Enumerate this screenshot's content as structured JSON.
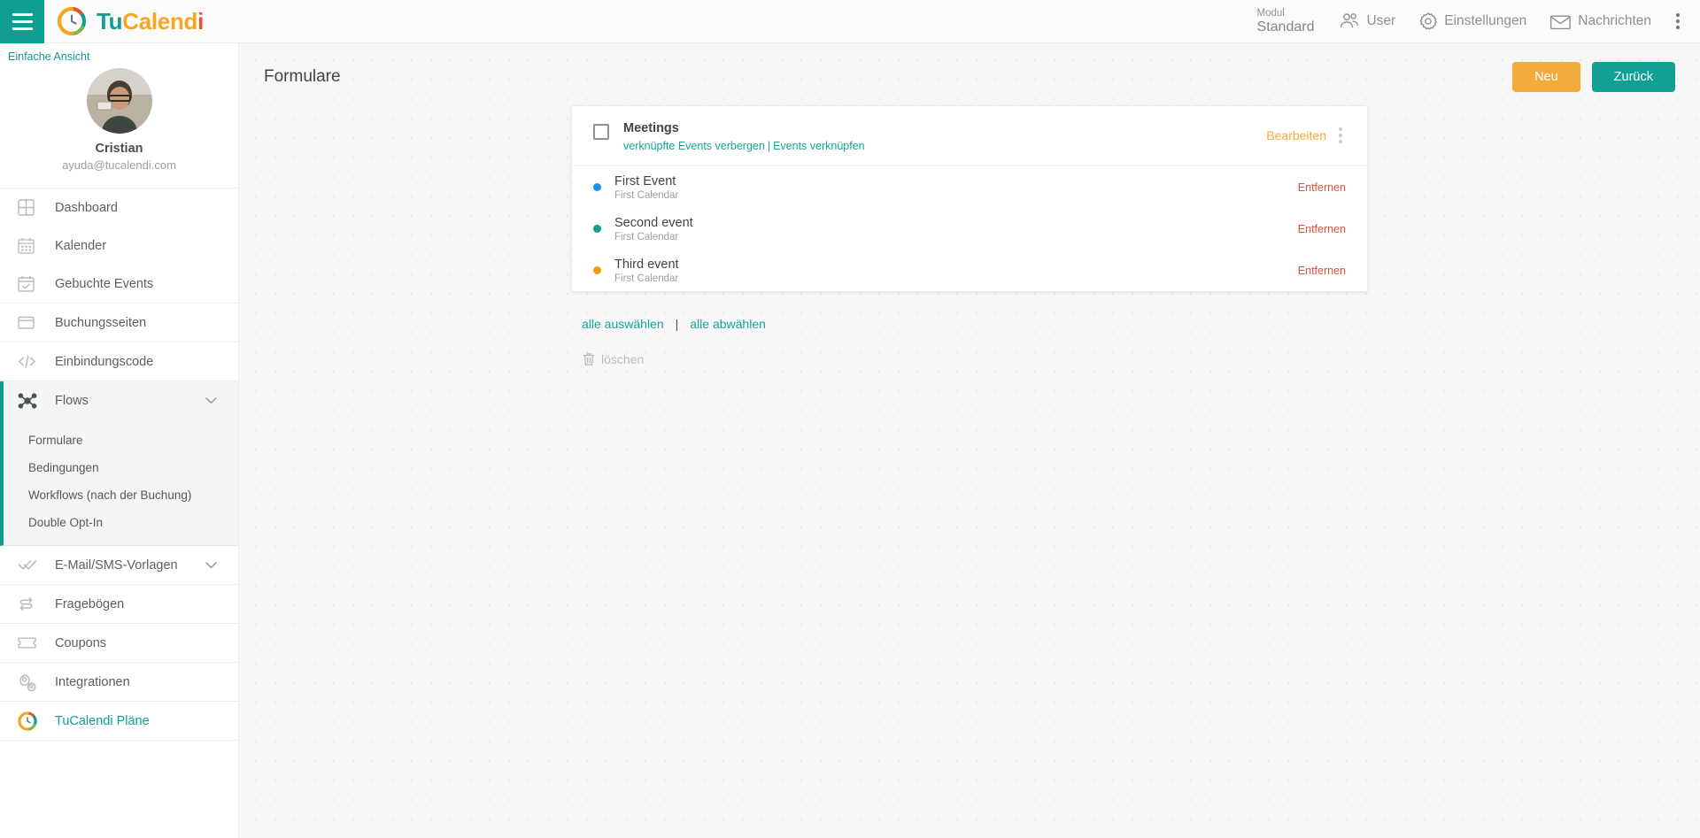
{
  "brand": {
    "part1": "Tu",
    "part2": "Calend",
    "part3": "i",
    "logo_icon": "tucalendi-logo-icon",
    "menu_icon": "hamburger-icon"
  },
  "topbar": {
    "modul_label": "Modul",
    "modul_value": "Standard",
    "items": [
      {
        "label": "User",
        "icon": "users-icon"
      },
      {
        "label": "Einstellungen",
        "icon": "gear-icon"
      },
      {
        "label": "Nachrichten",
        "icon": "envelope-icon"
      }
    ],
    "overflow_icon": "vertical-dots-icon"
  },
  "sidebar": {
    "simple_view": "Einfache Ansicht",
    "profile": {
      "name": "Cristian",
      "email": "ayuda@tucalendi.com",
      "avatar_icon": "user-avatar"
    },
    "items": [
      {
        "label": "Dashboard",
        "icon": "dashboard-grid-icon"
      },
      {
        "label": "Kalender",
        "icon": "calendar-icon"
      },
      {
        "label": "Gebuchte Events",
        "icon": "calendar-check-icon"
      },
      {
        "label": "Buchungsseiten",
        "icon": "window-icon"
      },
      {
        "label": "Einbindungscode",
        "icon": "code-icon"
      },
      {
        "label": "Flows",
        "icon": "flows-icon"
      },
      {
        "label": "E-Mail/SMS-Vorlagen",
        "icon": "double-check-icon"
      },
      {
        "label": "Fragebögen",
        "icon": "survey-icon"
      },
      {
        "label": "Coupons",
        "icon": "ticket-icon"
      },
      {
        "label": "Integrationen",
        "icon": "gears-icon"
      },
      {
        "label": "TuCalendi Pläne",
        "icon": "tucalendi-logo-icon"
      }
    ],
    "flows_subitems": [
      {
        "label": "Formulare"
      },
      {
        "label": "Bedingungen"
      },
      {
        "label": "Workflows (nach der Buchung)"
      },
      {
        "label": "Double Opt-In"
      }
    ]
  },
  "main": {
    "page_title": "Formulare",
    "buttons": {
      "new": "Neu",
      "back": "Zurück"
    },
    "form": {
      "name": "Meetings",
      "link_hide": "verknüpfte Events verbergen",
      "link_separator": "|",
      "link_attach": "Events verknüpfen",
      "edit": "Bearbeiten",
      "menu_icon": "vertical-dots-icon",
      "checkbox_checked": false,
      "events": [
        {
          "title": "First Event",
          "calendar": "First Calendar",
          "color": "#1e90e8",
          "remove": "Entfernen"
        },
        {
          "title": "Second event",
          "calendar": "First Calendar",
          "color": "#0f9e8c",
          "remove": "Entfernen"
        },
        {
          "title": "Third event",
          "calendar": "First Calendar",
          "color": "#f79a12",
          "remove": "Entfernen"
        }
      ]
    },
    "select_all": "alle auswählen",
    "select_divider": "|",
    "deselect_all": "alle abwählen",
    "delete": {
      "label": "löschen",
      "icon": "trash-icon"
    }
  },
  "colors": {
    "teal": "#0f9e91",
    "orange": "#f3a93a",
    "red": "#e0503b",
    "sidebar_text": "#5a5f65"
  }
}
